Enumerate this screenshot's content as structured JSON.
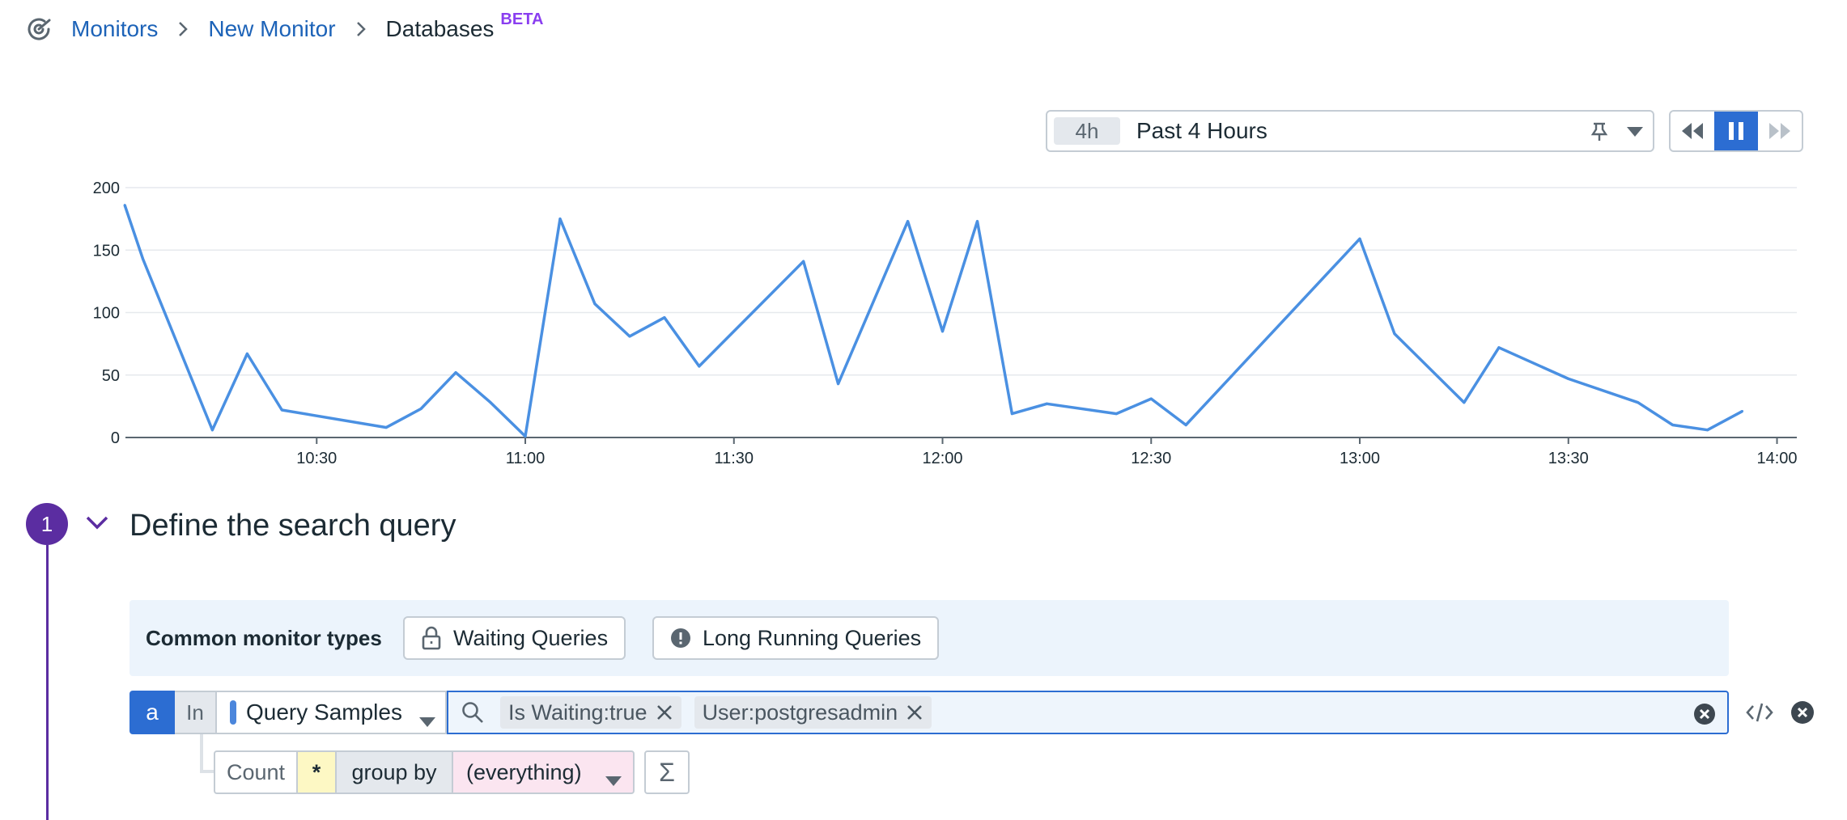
{
  "breadcrumb": {
    "items": [
      {
        "label": "Monitors"
      },
      {
        "label": "New Monitor"
      },
      {
        "label": "Databases"
      }
    ],
    "badge": "BETA"
  },
  "time_controls": {
    "badge": "4h",
    "label": "Past 4 Hours"
  },
  "chart_data": {
    "type": "line",
    "title": "",
    "xlabel": "",
    "ylabel": "",
    "ylim": [
      0,
      200
    ],
    "y_ticks": [
      "0",
      "50",
      "100",
      "150",
      "200"
    ],
    "x_ticks": [
      {
        "label": "10:30",
        "min": 630
      },
      {
        "label": "11:00",
        "min": 660
      },
      {
        "label": "11:30",
        "min": 690
      },
      {
        "label": "12:00",
        "min": 720
      },
      {
        "label": "12:30",
        "min": 750
      },
      {
        "label": "13:00",
        "min": 780
      },
      {
        "label": "13:30",
        "min": 810
      },
      {
        "label": "14:00",
        "min": 840
      }
    ],
    "x_range_min": [
      602.5,
      842.5
    ],
    "grid": true,
    "color": "#4a90e2",
    "points": [
      [
        602.4,
        186
      ],
      [
        605,
        143
      ],
      [
        615,
        6
      ],
      [
        620,
        67
      ],
      [
        625,
        22
      ],
      [
        640,
        8
      ],
      [
        645,
        23
      ],
      [
        650,
        52
      ],
      [
        655,
        28
      ],
      [
        660,
        1
      ],
      [
        665,
        175
      ],
      [
        670,
        107
      ],
      [
        675,
        81
      ],
      [
        680,
        96
      ],
      [
        685,
        57
      ],
      [
        700,
        141
      ],
      [
        705,
        43
      ],
      [
        715,
        173
      ],
      [
        720,
        85
      ],
      [
        725,
        173
      ],
      [
        730,
        19
      ],
      [
        735,
        27
      ],
      [
        745,
        19
      ],
      [
        750,
        31
      ],
      [
        755,
        10
      ],
      [
        780,
        159
      ],
      [
        785,
        83
      ],
      [
        795,
        28
      ],
      [
        800,
        72
      ],
      [
        810,
        47
      ],
      [
        820,
        28
      ],
      [
        825,
        10
      ],
      [
        830,
        6
      ],
      [
        835,
        21
      ]
    ]
  },
  "step": {
    "number": "1",
    "title": "Define the search query"
  },
  "common_types": {
    "label": "Common monitor types",
    "buttons": [
      "Waiting Queries",
      "Long Running Queries"
    ]
  },
  "query": {
    "letter": "a",
    "in_label": "In",
    "source": "Query Samples",
    "tags": [
      "Is Waiting:true",
      "User:postgresadmin"
    ],
    "aggregation": "Count",
    "measure": "*",
    "group_by_label": "group by",
    "group_by_value": "(everything)",
    "sigma": "Σ"
  },
  "colors": {
    "accent": "#2c6dd2",
    "step": "#5b2da1",
    "line": "#4a90e2",
    "link": "#1d63b8",
    "beta": "#8a3ef0"
  }
}
